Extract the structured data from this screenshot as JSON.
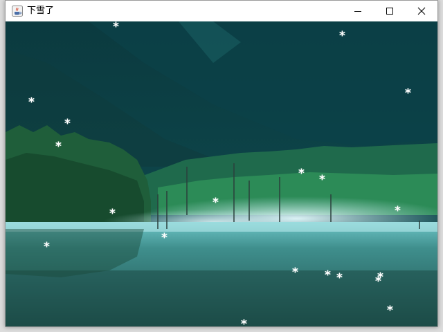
{
  "window": {
    "title": "下雪了",
    "app_icon": "java-cup-icon",
    "controls": {
      "minimize_icon": "minimize-icon",
      "maximize_icon": "maximize-icon",
      "close_icon": "close-icon"
    }
  },
  "canvas": {
    "background_image": "misty-mountain-lake-scene",
    "snowflake_char": "*",
    "snowflake_color": "#ffffff",
    "snowflake_count": 20
  }
}
